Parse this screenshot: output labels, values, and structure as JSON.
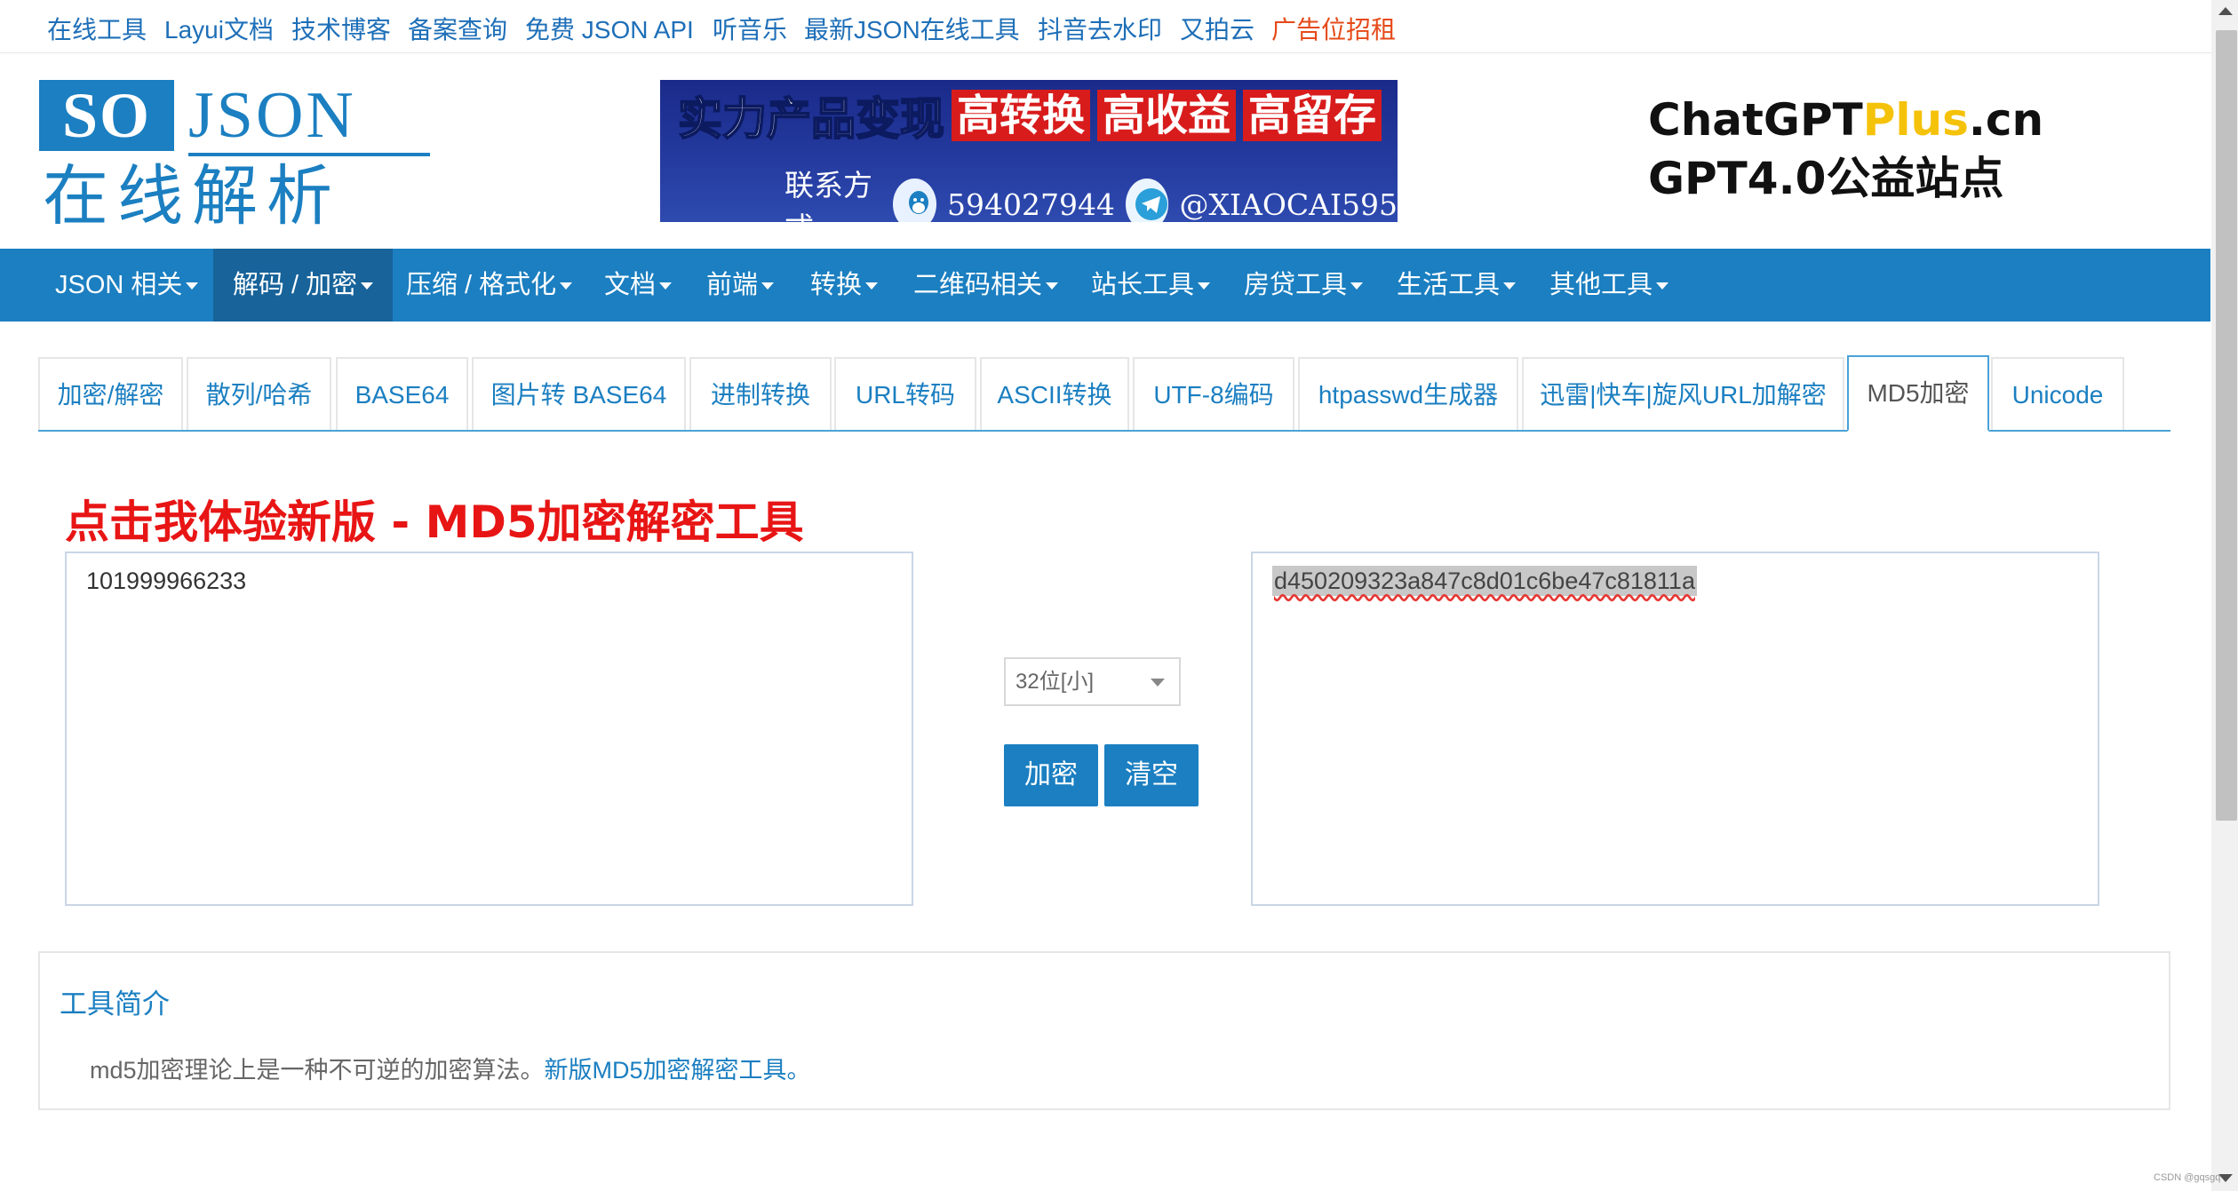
{
  "top_links": [
    {
      "label": "在线工具"
    },
    {
      "label": "Layui文档"
    },
    {
      "label": "技术博客"
    },
    {
      "label": "备案查询"
    },
    {
      "label": "免费 JSON API"
    },
    {
      "label": "听音乐"
    },
    {
      "label": "最新JSON在线工具"
    },
    {
      "label": "抖音去水印"
    },
    {
      "label": "又拍云"
    },
    {
      "label": "广告位招租"
    }
  ],
  "logo": {
    "so": "SO",
    "json": "JSON",
    "cn": "在线解析"
  },
  "banner": {
    "lead": "实力产品变现",
    "tags": [
      "高转换",
      "高收益",
      "高留存"
    ],
    "contact_label": "联系方式",
    "qq": "594027944",
    "telegram": "@XIAOCAI595"
  },
  "promo": {
    "line1_a": "ChatGPT",
    "line1_b": "Plus",
    "line1_c": ".cn",
    "line2": "GPT4.0公益站点"
  },
  "nav": [
    {
      "label": "JSON 相关"
    },
    {
      "label": "解码 / 加密"
    },
    {
      "label": "压缩 / 格式化"
    },
    {
      "label": "文档"
    },
    {
      "label": "前端"
    },
    {
      "label": "转换"
    },
    {
      "label": "二维码相关"
    },
    {
      "label": "站长工具"
    },
    {
      "label": "房贷工具"
    },
    {
      "label": "生活工具"
    },
    {
      "label": "其他工具"
    }
  ],
  "tabs": [
    {
      "label": "加密/解密"
    },
    {
      "label": "散列/哈希"
    },
    {
      "label": "BASE64"
    },
    {
      "label": "图片转 BASE64"
    },
    {
      "label": "进制转换"
    },
    {
      "label": "URL转码"
    },
    {
      "label": "ASCII转换"
    },
    {
      "label": "UTF-8编码"
    },
    {
      "label": "htpasswd生成器"
    },
    {
      "label": "迅雷|快车|旋风URL加解密"
    },
    {
      "label": "MD5加密"
    },
    {
      "label": "Unicode"
    }
  ],
  "headline": "点击我体验新版 - MD5加密解密工具",
  "input_value": "101999966233",
  "output_value": "d450209323a847c8d01c6be47c81811a",
  "select_value": "32位[小]",
  "buttons": {
    "encrypt": "加密",
    "clear": "清空"
  },
  "intro": {
    "title": "工具简介",
    "desc": "md5加密理论上是一种不可逆的加密算法。",
    "link": "新版MD5加密解密工具。"
  },
  "watermark": "CSDN @gqsgq",
  "colors": {
    "brand": "#1b7fc1",
    "headline": "#e81515",
    "ad_link": "#e64a19",
    "promo_plus": "#f5c20a"
  }
}
